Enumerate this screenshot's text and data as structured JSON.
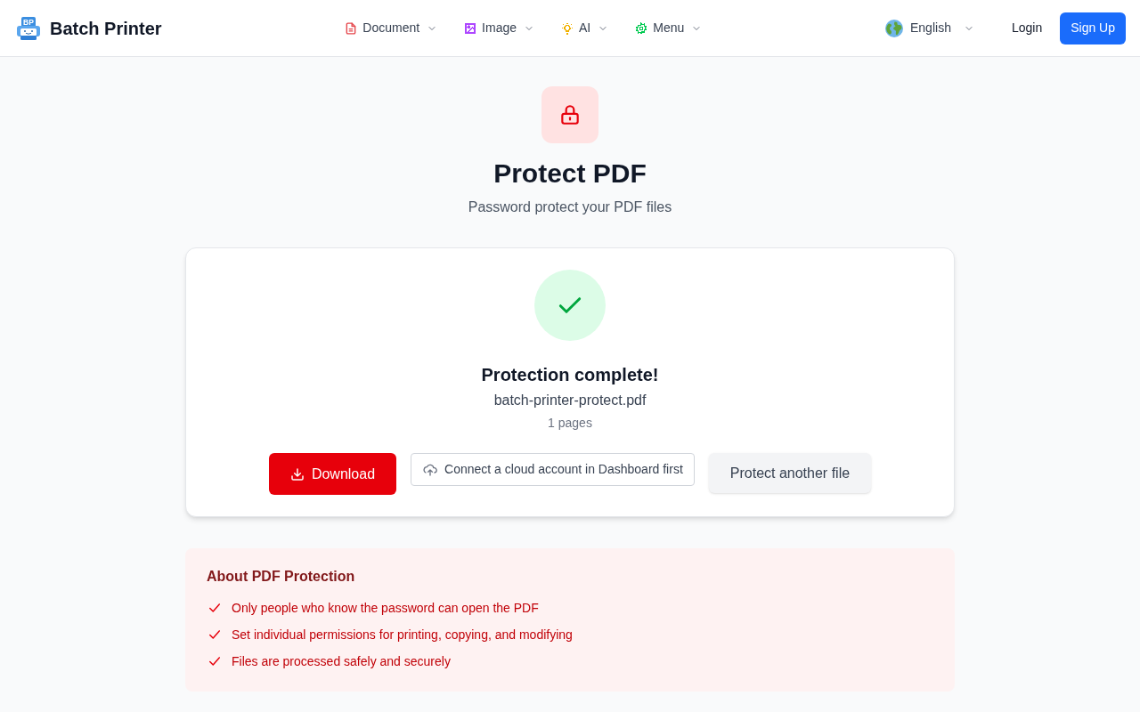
{
  "header": {
    "logo_text": "BP",
    "brand": "Batch Printer",
    "nav": [
      {
        "label": "Document",
        "color": "#e5484d"
      },
      {
        "label": "Image",
        "color": "#ad46ff"
      },
      {
        "label": "AI",
        "color": "#f0b100"
      },
      {
        "label": "Menu",
        "color": "#00c950"
      }
    ],
    "language": "English",
    "login": "Login",
    "signup": "Sign Up"
  },
  "page": {
    "title": "Protect PDF",
    "subtitle": "Password protect your PDF files"
  },
  "result": {
    "status": "Protection complete!",
    "filename": "batch-printer-protect.pdf",
    "pages": "1 pages",
    "actions": [
      {
        "kind": "primary",
        "label": "Download"
      },
      {
        "kind": "outline",
        "label": "Connect a cloud account in Dashboard first"
      },
      {
        "kind": "secondary",
        "label": "Protect another file"
      }
    ]
  },
  "info": {
    "title": "About PDF Protection",
    "points": [
      "Only people who know the password can open the PDF",
      "Set individual permissions for printing, copying, and modifying",
      "Files are processed safely and securely"
    ]
  }
}
